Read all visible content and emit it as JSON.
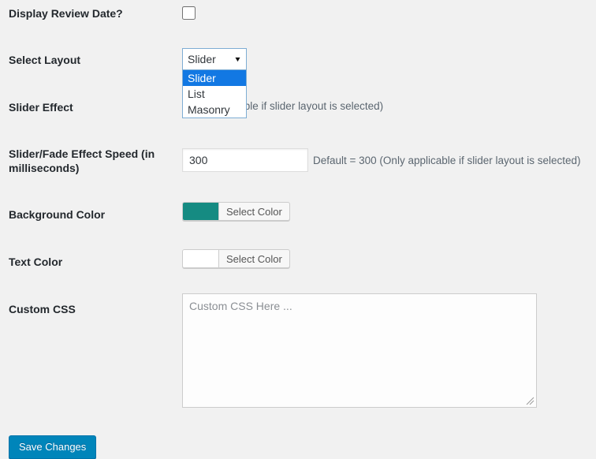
{
  "form": {
    "rows": [
      {
        "id": "display-review-date",
        "label": "Display Review Date?",
        "control": "checkbox",
        "checked": false
      },
      {
        "id": "select-layout",
        "label": "Select Layout",
        "control": "select",
        "value": "Slider",
        "expanded": true,
        "caret": "▼",
        "options": [
          {
            "label": "Slider",
            "selected": true
          },
          {
            "label": "List",
            "selected": false
          },
          {
            "label": "Masonry",
            "selected": false
          }
        ]
      },
      {
        "id": "slider-effect",
        "label": "Slider Effect",
        "control": "select-hidden",
        "help": "(Only applicable if slider layout is selected)"
      },
      {
        "id": "slider-fade-effect-speed",
        "label": "Slider/Fade Effect Speed (in milliseconds)",
        "control": "text",
        "value": "300",
        "help": "Default = 300 (Only applicable if slider layout is selected)"
      },
      {
        "id": "background-color",
        "label": "Background Color",
        "control": "color",
        "button_label": "Select Color",
        "swatch": "#158b82"
      },
      {
        "id": "text-color",
        "label": "Text Color",
        "control": "color",
        "button_label": "Select Color",
        "swatch": "#ffffff"
      },
      {
        "id": "custom-css",
        "label": "Custom CSS",
        "control": "textarea",
        "value": "",
        "placeholder": "Custom CSS Here ..."
      }
    ],
    "submit_label": "Save Changes"
  },
  "colors": {
    "page_background": "#f1f1f1",
    "accent_blue": "#0085ba",
    "highlight_blue": "#1278e3",
    "swatch_teal": "#158b82",
    "help_text": "#5b6670"
  }
}
